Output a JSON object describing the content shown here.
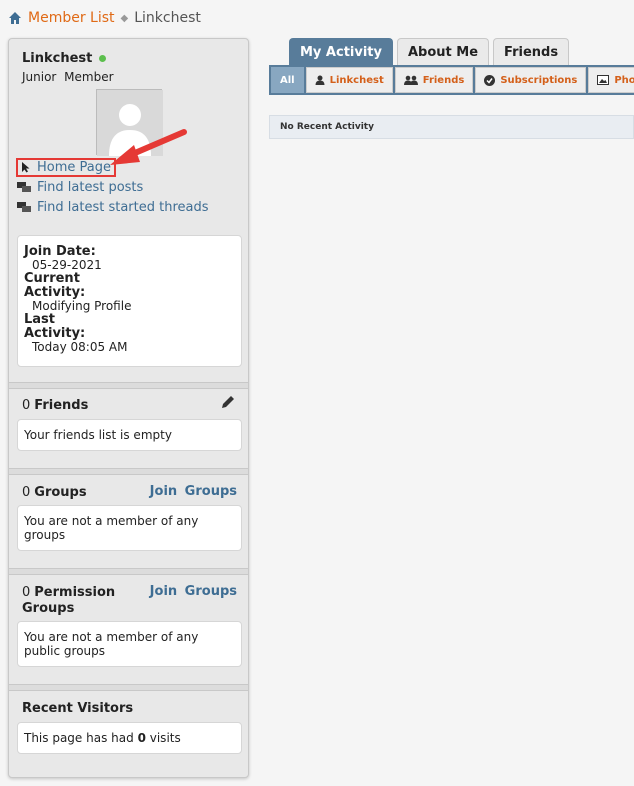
{
  "breadcrumb": {
    "link": "Member List",
    "current": "Linkchest"
  },
  "profile": {
    "name": "Linkchest",
    "rank": "Junior Member"
  },
  "links": [
    {
      "label": "Home Page",
      "icon": "cursor-icon"
    },
    {
      "label": "Find latest posts",
      "icon": "posts-icon"
    },
    {
      "label": "Find latest started threads",
      "icon": "threads-icon"
    }
  ],
  "about": {
    "join_label": "Join Date:",
    "join_value": "05-29-2021",
    "activity_label_1": "Current",
    "activity_label_2": "Activity:",
    "activity_value": "Modifying Profile",
    "last_label_1": "Last",
    "last_label_2": "Activity:",
    "last_value": "Today 08:05 AM"
  },
  "friends": {
    "count": "0",
    "title": "Friends",
    "empty": "Your friends list is empty"
  },
  "groups": {
    "count": "0",
    "title": "Groups",
    "join": "Join Groups",
    "empty": "You are not a member of any groups"
  },
  "permission_groups": {
    "count": "0",
    "title_1": "Permission",
    "title_2": "Groups",
    "join": "Join Groups",
    "empty": "You are not a member of any public groups"
  },
  "visitors": {
    "title": "Recent Visitors",
    "text_before": "This page has had",
    "count": "0",
    "text_after": "visits"
  },
  "tabs": [
    "My Activity",
    "About Me",
    "Friends"
  ],
  "subtabs": [
    "All",
    "Linkchest",
    "Friends",
    "Subscriptions",
    "Photos"
  ],
  "activity_empty": "No Recent Activity",
  "colors": {
    "accent": "#587c9a",
    "link": "#3e6d93",
    "orange": "#e06a16",
    "highlight": "#e53935"
  }
}
